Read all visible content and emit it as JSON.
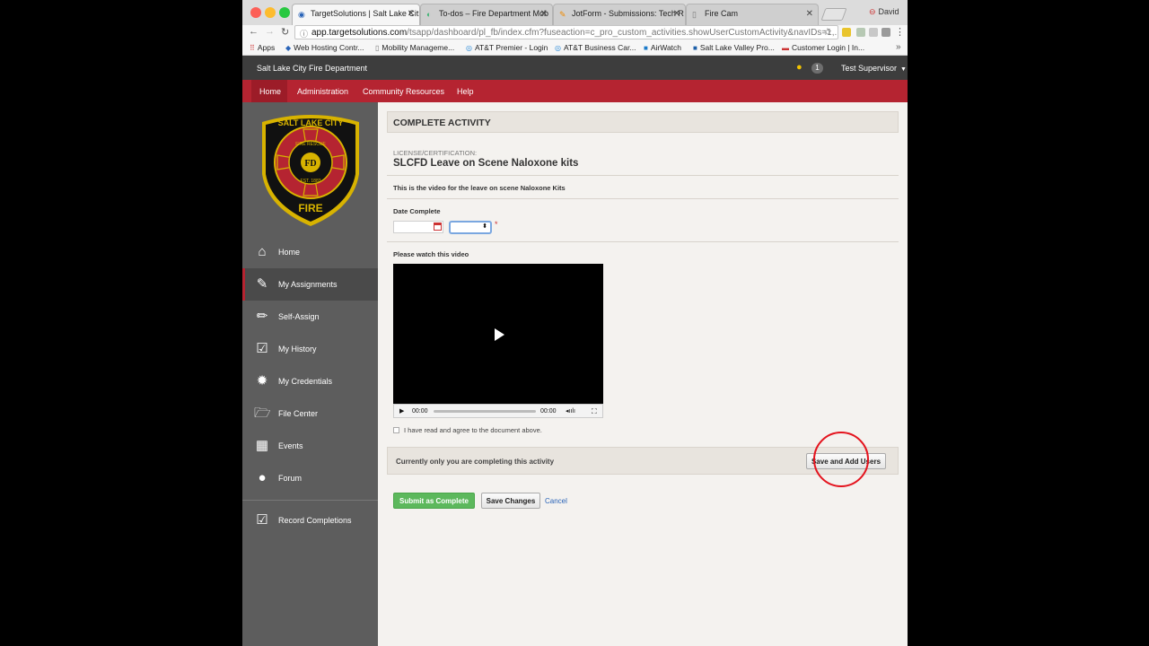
{
  "browser": {
    "tabs": [
      {
        "title": "TargetSolutions | Salt Lake Cit",
        "icon": "ts-favicon"
      },
      {
        "title": "To-dos – Fire Department Mob",
        "icon": "basecamp-favicon"
      },
      {
        "title": "JotForm - Submissions: Tech R",
        "icon": "jotform-favicon"
      },
      {
        "title": "Fire Cam",
        "icon": "doc-favicon"
      }
    ],
    "profile": "David",
    "url_host": "app.targetsolutions.com",
    "url_rest": "/tsapp/dashboard/pl_fb/index.cfm?fuseaction=c_pro_custom_activities.showUserCustomActivity&navIDs=1,...",
    "bookmarks": [
      "Apps",
      "Web Hosting Contr...",
      "Mobility Manageme...",
      "AT&T Premier - Login",
      "AT&T Business Car...",
      "AirWatch",
      "Salt Lake Valley Pro...",
      "Customer Login | In..."
    ]
  },
  "header": {
    "org_name": "Salt Lake City Fire Department",
    "notification_count": "1",
    "user_name": "Test Supervisor"
  },
  "nav": {
    "items": [
      "Home",
      "Administration",
      "Community Resources",
      "Help"
    ]
  },
  "sidebar": {
    "badge_text": {
      "top": "SALT LAKE CITY",
      "ring": "FIRE RESCUE",
      "center": "FD",
      "est": "EST. 1883",
      "bottom": "FIRE"
    },
    "items": [
      {
        "label": "Home",
        "icon": "home-icon"
      },
      {
        "label": "My Assignments",
        "icon": "edit-icon"
      },
      {
        "label": "Self-Assign",
        "icon": "pencil-icon"
      },
      {
        "label": "My History",
        "icon": "checkbox-icon"
      },
      {
        "label": "My Credentials",
        "icon": "badge-icon"
      },
      {
        "label": "File Center",
        "icon": "folder-icon"
      },
      {
        "label": "Events",
        "icon": "calendar-icon"
      },
      {
        "label": "Forum",
        "icon": "chat-icon"
      },
      {
        "label": "Record Completions",
        "icon": "checkbox-icon"
      }
    ]
  },
  "main": {
    "heading": "COMPLETE ACTIVITY",
    "type_label": "LICENSE/CERTIFICATION:",
    "activity_title": "SLCFD Leave on Scene Naloxone kits",
    "description": "This is the video for the leave on scene Naloxone Kits",
    "date_label": "Date Complete",
    "date_value": "",
    "watch_label": "Please watch this video",
    "video": {
      "current_time": "00:00",
      "duration": "00:00"
    },
    "agree_label": "I have read and agree to the document above.",
    "info_text": "Currently only you are completing this activity",
    "save_add_users": "Save and Add Users",
    "submit": "Submit as Complete",
    "save_changes": "Save Changes",
    "cancel": "Cancel"
  },
  "colors": {
    "nav_red": "#b52431",
    "header_dark": "#3d3d3d",
    "sidebar_gray": "#5d5d5d",
    "submit_green": "#5cb85c",
    "annotation_red": "#e4141e"
  }
}
